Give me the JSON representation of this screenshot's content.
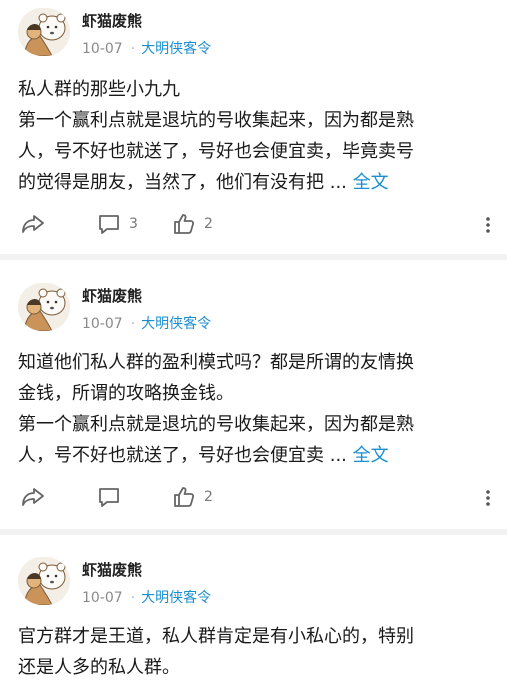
{
  "posts": [
    {
      "author": "虾猫废熊",
      "date": "10-07",
      "topic": "大明侠客令",
      "lines": [
        "私人群的那些小九九",
        "第一个赢利点就是退坑的号收集起来，因为都是熟",
        "人，号不好也就送了，号好也会便宜卖，毕竟卖号",
        "的觉得是朋友，当然了，他们有没有把 ..."
      ],
      "more": "全文",
      "comments": "3",
      "likes": "2"
    },
    {
      "author": "虾猫废熊",
      "date": "10-07",
      "topic": "大明侠客令",
      "lines": [
        "知道他们私人群的盈利模式吗？都是所谓的友情换",
        "金钱，所谓的攻略换金钱。",
        "第一个赢利点就是退坑的号收集起来，因为都是熟",
        "人，号不好也就送了，号好也会便宜卖 ..."
      ],
      "more": "全文",
      "comments": "",
      "likes": "2"
    },
    {
      "author": "虾猫废熊",
      "date": "10-07",
      "topic": "大明侠客令",
      "lines": [
        "官方群才是王道，私人群肯定是有小私心的，特别",
        "还是人多的私人群。"
      ]
    }
  ],
  "icons": {
    "share": "share-icon",
    "comment": "comment-icon",
    "like": "thumbs-up-icon",
    "more": "more-vertical-icon"
  },
  "colors": {
    "link": "#1a8fd0",
    "meta": "#8a8a8a",
    "icon": "#666666",
    "divider": "#f2f2f2"
  }
}
